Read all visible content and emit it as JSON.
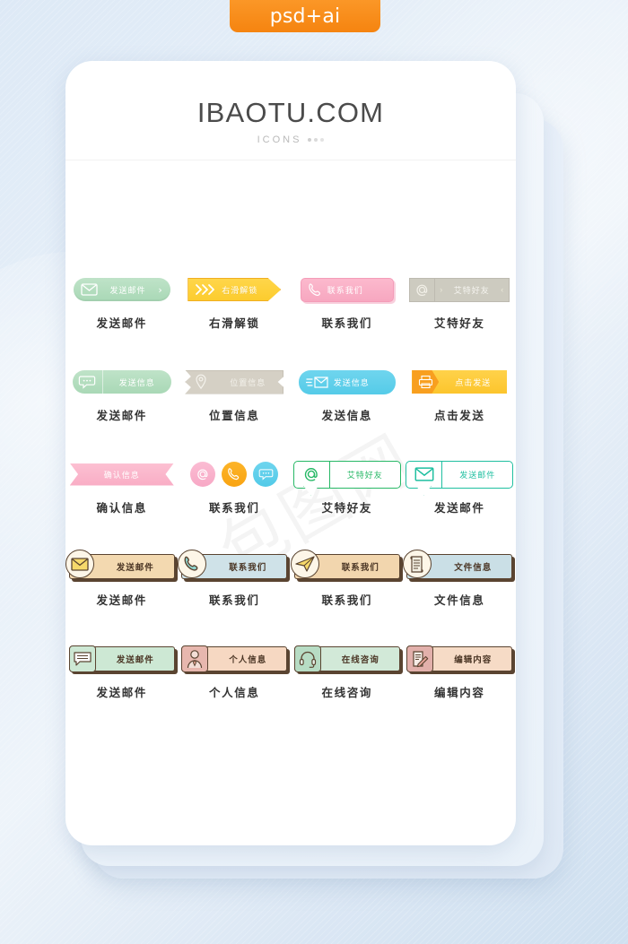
{
  "badge": {
    "label": "psd+ai"
  },
  "header": {
    "title": "IBAOTU.COM",
    "subtitle": "ICONS"
  },
  "watermark": {
    "text": "包图网"
  },
  "icons": [
    {
      "button_label": "发送邮件",
      "caption": "发送邮件",
      "icon": "envelope-icon",
      "style": "mint-pill",
      "chevron": "›"
    },
    {
      "button_label": "右滑解锁",
      "caption": "右滑解锁",
      "icon": "double-chevron-right-icon",
      "style": "yellow-arrow"
    },
    {
      "button_label": "联系我们",
      "caption": "联系我们",
      "icon": "phone-handset-icon",
      "style": "pink-sketch"
    },
    {
      "button_label": "艾特好友",
      "caption": "艾特好友",
      "icon": "at-sign-icon",
      "style": "gray-segmented",
      "chevron_left": "›",
      "chevron_right": "‹"
    },
    {
      "button_label": "发送信息",
      "caption": "发送邮件",
      "icon": "chat-bubble-icon",
      "style": "mint-pill-split"
    },
    {
      "button_label": "位置信息",
      "caption": "位置信息",
      "icon": "map-pin-icon",
      "style": "taupe-ribbon"
    },
    {
      "button_label": "发送信息",
      "caption": "发送信息",
      "icon": "flying-envelope-icon",
      "style": "cyan-pill"
    },
    {
      "button_label": "点击发送",
      "caption": "点击发送",
      "icon": "printer-icon",
      "style": "orange-segmented"
    },
    {
      "button_label": "确认信息",
      "caption": "确认信息",
      "icon": "none",
      "style": "pink-banner"
    },
    {
      "button_label": "",
      "caption": "联系我们",
      "icon": "three-circles",
      "style": "circles"
    },
    {
      "button_label": "艾特好友",
      "caption": "艾特好友",
      "icon": "at-sign-icon",
      "style": "green-bubble"
    },
    {
      "button_label": "发送邮件",
      "caption": "发送邮件",
      "icon": "envelope-icon",
      "style": "teal-bubble"
    },
    {
      "button_label": "发送邮件",
      "caption": "发送邮件",
      "icon": "envelope-filled-icon",
      "style": "hand-tan"
    },
    {
      "button_label": "联系我们",
      "caption": "联系我们",
      "icon": "phone-handset-icon",
      "style": "hand-blue"
    },
    {
      "button_label": "联系我们",
      "caption": "联系我们",
      "icon": "paper-plane-icon",
      "style": "hand-tan2"
    },
    {
      "button_label": "文件信息",
      "caption": "文件信息",
      "icon": "scroll-document-icon",
      "style": "hand-blue2"
    },
    {
      "button_label": "发送邮件",
      "caption": "发送邮件",
      "icon": "chat-lines-icon",
      "style": "hand-mint"
    },
    {
      "button_label": "个人信息",
      "caption": "个人信息",
      "icon": "user-avatar-icon",
      "style": "hand-peach"
    },
    {
      "button_label": "在线咨询",
      "caption": "在线咨询",
      "icon": "headset-icon",
      "style": "hand-mint2"
    },
    {
      "button_label": "编辑内容",
      "caption": "编辑内容",
      "icon": "document-pencil-icon",
      "style": "hand-peach2"
    }
  ],
  "colors": {
    "accent_orange": "#f58410",
    "mint": "#a9d8b6",
    "yellow": "#fccc2e",
    "pink": "#f7a7c0",
    "gray": "#cdcbc0",
    "cyan": "#55cbe8",
    "green": "#27b866",
    "teal": "#1fbfa0",
    "ink": "#5a4431",
    "page_bg": "#e2ecf7"
  }
}
